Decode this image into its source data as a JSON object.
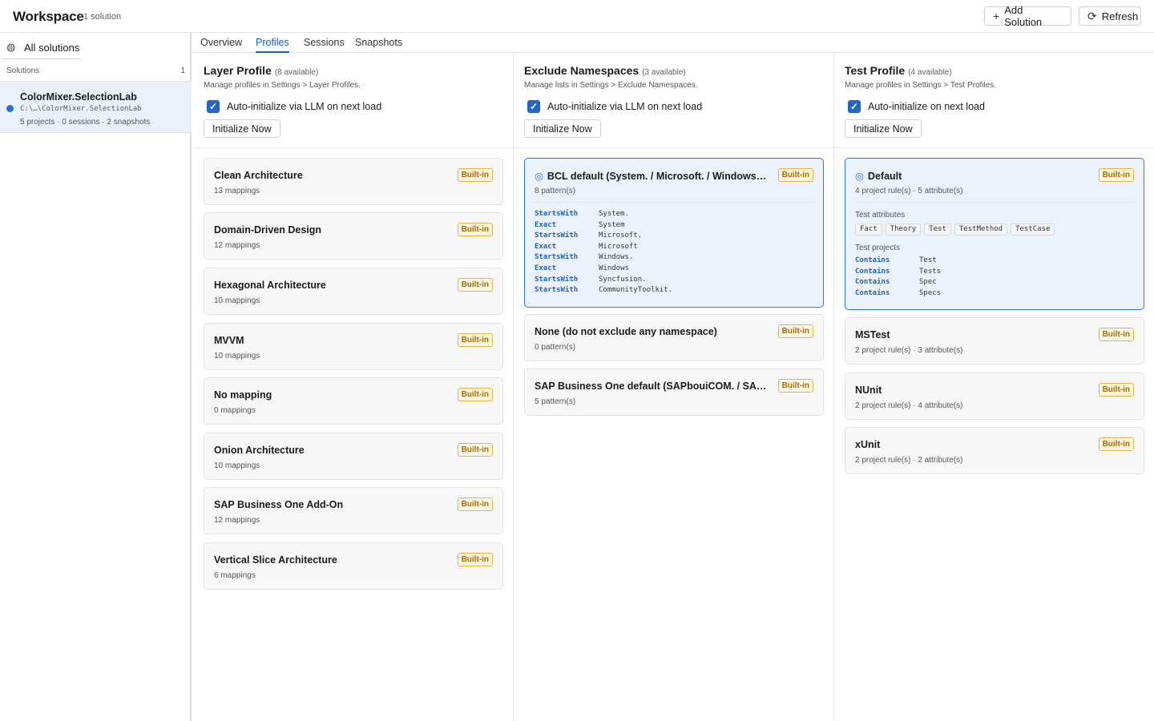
{
  "header": {
    "title": "Workspace",
    "count": "1 solution",
    "add_solution_label": "Add Solution",
    "refresh_label": "Refresh"
  },
  "sidebar": {
    "all_solutions_label": "All solutions",
    "solutions_heading": "Solutions",
    "solutions_count": "1",
    "items": [
      {
        "name": "ColorMixer.SelectionLab",
        "path": "C:\\…\\ColorMixer.SelectionLab",
        "meta": "5 projects · 0 sessions · 2 snapshots"
      }
    ]
  },
  "tabs": [
    {
      "label": "Overview"
    },
    {
      "label": "Profiles",
      "active": true
    },
    {
      "label": "Sessions"
    },
    {
      "label": "Snapshots"
    }
  ],
  "columns": {
    "layer": {
      "title": "Layer Profile",
      "available": "(8 available)",
      "subtitle": "Manage profiles in Settings > Layer Profiles.",
      "auto_init_label": "Auto-initialize via LLM on next load",
      "auto_init_checked": true,
      "init_button": "Initialize Now",
      "cards": [
        {
          "name": "Clean Architecture",
          "meta": "13 mappings",
          "badge": "Built-in"
        },
        {
          "name": "Domain-Driven Design",
          "meta": "12 mappings",
          "badge": "Built-in"
        },
        {
          "name": "Hexagonal Architecture",
          "meta": "10 mappings",
          "badge": "Built-in"
        },
        {
          "name": "MVVM",
          "meta": "10 mappings",
          "badge": "Built-in"
        },
        {
          "name": "No mapping",
          "meta": "0 mappings",
          "badge": "Built-in"
        },
        {
          "name": "Onion Architecture",
          "meta": "10 mappings",
          "badge": "Built-in"
        },
        {
          "name": "SAP Business One Add-On",
          "meta": "12 mappings",
          "badge": "Built-in"
        },
        {
          "name": "Vertical Slice Architecture",
          "meta": "6 mappings",
          "badge": "Built-in"
        }
      ]
    },
    "exclude": {
      "title": "Exclude Namespaces",
      "available": "(3 available)",
      "subtitle": "Manage lists in Settings > Exclude Namespaces.",
      "auto_init_label": "Auto-initialize via LLM on next load",
      "auto_init_checked": true,
      "init_button": "Initialize Now",
      "cards": [
        {
          "name": "BCL default (System. / Microsoft. / Windows. / Syn...",
          "meta": "8 pattern(s)",
          "badge": "Built-in",
          "selected": true,
          "rules": [
            {
              "op": "StartsWith",
              "val": "System."
            },
            {
              "op": "Exact",
              "val": "System"
            },
            {
              "op": "StartsWith",
              "val": "Microsoft."
            },
            {
              "op": "Exact",
              "val": "Microsoft"
            },
            {
              "op": "StartsWith",
              "val": "Windows."
            },
            {
              "op": "Exact",
              "val": "Windows"
            },
            {
              "op": "StartsWith",
              "val": "Syncfusion."
            },
            {
              "op": "StartsWith",
              "val": "CommunityToolkit."
            }
          ]
        },
        {
          "name": "None (do not exclude any namespace)",
          "meta": "0 pattern(s)",
          "badge": "Built-in"
        },
        {
          "name": "SAP Business One default (SAPbouiCOM. / SAPbobsC...",
          "meta": "5 pattern(s)",
          "badge": "Built-in"
        }
      ]
    },
    "test": {
      "title": "Test Profile",
      "available": "(4 available)",
      "subtitle": "Manage profiles in Settings > Test Profiles.",
      "auto_init_label": "Auto-initialize on next load",
      "auto_init_checked": true,
      "init_button": "Initialize Now",
      "cards": [
        {
          "name": "Default",
          "meta": "4 project rule(s) · 5 attribute(s)",
          "badge": "Built-in",
          "selected": true,
          "attributes_label": "Test attributes",
          "attributes": [
            "Fact",
            "Theory",
            "Test",
            "TestMethod",
            "TestCase"
          ],
          "projects_label": "Test projects",
          "rules": [
            {
              "op": "Contains",
              "val": "Test"
            },
            {
              "op": "Contains",
              "val": "Tests"
            },
            {
              "op": "Contains",
              "val": "Spec"
            },
            {
              "op": "Contains",
              "val": "Specs"
            }
          ]
        },
        {
          "name": "MSTest",
          "meta": "2 project rule(s) · 3 attribute(s)",
          "badge": "Built-in"
        },
        {
          "name": "NUnit",
          "meta": "2 project rule(s) · 4 attribute(s)",
          "badge": "Built-in"
        },
        {
          "name": "xUnit",
          "meta": "2 project rule(s) · 2 attribute(s)",
          "badge": "Built-in"
        }
      ]
    }
  },
  "colors": {
    "accent": "#2265c8",
    "badge_text": "#a86b00",
    "badge_bg": "#fdf6e2",
    "selected_bg": "#ebf2fc"
  }
}
